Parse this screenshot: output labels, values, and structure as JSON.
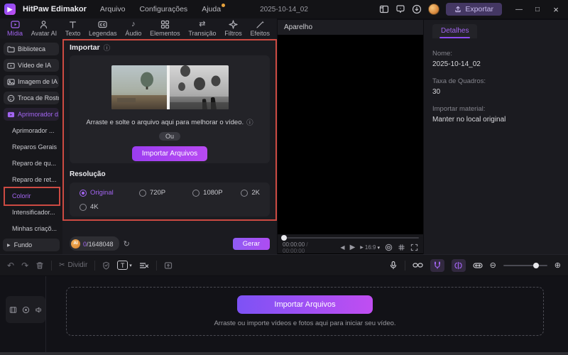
{
  "titlebar": {
    "app_name": "HitPaw Edimakor",
    "menus": [
      "Arquivo",
      "Configurações",
      "Ajuda"
    ],
    "project_title": "2025-10-14_02",
    "export_label": "Exportar"
  },
  "tabs": [
    "Mídia",
    "Avatar AI",
    "Texto",
    "Legendas",
    "Áudio",
    "Elementos",
    "Transição",
    "Filtros",
    "Efeitos"
  ],
  "sidebar": {
    "items": [
      "Biblioteca",
      "Vídeo de IA",
      "Imagem de IA",
      "Troca de Rostos",
      "Aprimorador d..."
    ],
    "sub_items": [
      "Aprimorador ...",
      "Reparos Gerais",
      "Reparo de qu...",
      "Reparo de ret...",
      "Colorir",
      "Intensificador...",
      "Minhas criaçõ..."
    ],
    "bottom": "Fundo"
  },
  "import_panel": {
    "title": "Importar",
    "dropzone_hint": "Arraste e solte o arquivo aqui para melhorar o vídeo.",
    "or_label": "Ou",
    "import_button": "Importar Arquivos",
    "resolution_label": "Resolução",
    "resolution_options": [
      "Original",
      "720P",
      "1080P",
      "2K",
      "4K"
    ],
    "resolution_selected": "Original",
    "credits_used": "0",
    "credits_total": "/1648048",
    "coin_label": "AI",
    "generate_button": "Gerar"
  },
  "preview": {
    "header": "Aparelho",
    "time_current": "00:00:00",
    "time_sep": "/",
    "time_total": "00:00:00",
    "ratio_label": "16:9"
  },
  "details": {
    "tab_label": "Detalhes",
    "fields": [
      {
        "label": "Nome:",
        "value": "2025-10-14_02"
      },
      {
        "label": "Taxa de Quadros:",
        "value": "30"
      },
      {
        "label": "Importar material:",
        "value": "Manter no local original"
      }
    ]
  },
  "toolbar": {
    "split_label": "Dividir",
    "text_tool_label": "T"
  },
  "timeline": {
    "import_button": "Importar Arquivos",
    "hint": "Arraste ou importe vídeos e fotos aqui para iniciar seu vídeo."
  },
  "icons": {
    "undo": "↶",
    "redo": "↷",
    "scissors": "✂",
    "info": "ⓘ",
    "refresh": "↻",
    "prev": "◀",
    "play": "▶",
    "zoom_out": "⊖",
    "zoom_in": "⊕",
    "dropdown": "▾",
    "chevron": "▶",
    "audio_note": "♪",
    "transition_arrows": "⇄",
    "minimize": "—",
    "maximize": "□",
    "close": "×",
    "logo_glyph": "▶"
  },
  "colors": {
    "accent_purple": "#a365f2",
    "highlight_red": "#cc4a42",
    "button_gradient": "#7d52f5 → #c04ef2",
    "coin_orange": "#e89a3c"
  }
}
